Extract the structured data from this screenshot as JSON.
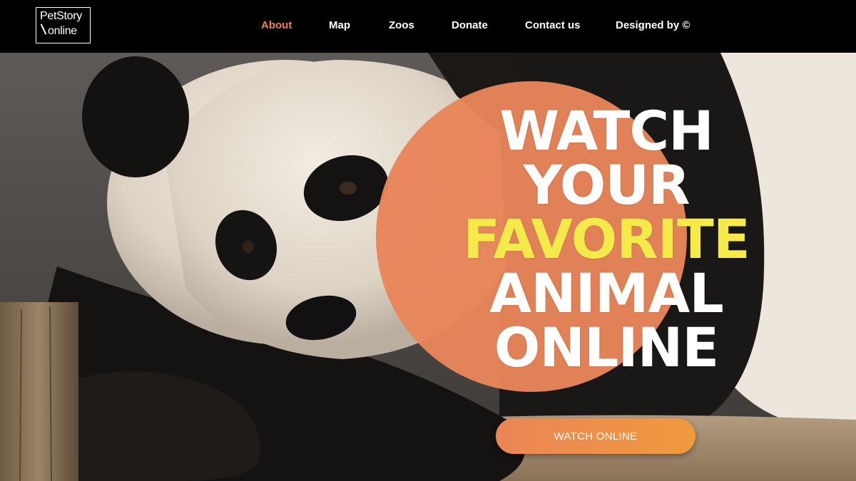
{
  "logo": {
    "line1": "PetStory",
    "line2": "online"
  },
  "nav": {
    "items": [
      {
        "label": "About",
        "active": true
      },
      {
        "label": "Map"
      },
      {
        "label": "Zoos"
      },
      {
        "label": "Donate"
      },
      {
        "label": "Contact us"
      },
      {
        "label": "Designed by ©"
      }
    ]
  },
  "hero": {
    "headline": {
      "line1": "WATCH",
      "line2": "YOUR",
      "line3": "FAVORITE",
      "line4": "ANIMAL",
      "line5": "ONLINE"
    },
    "cta_label": "WATCH ONLINE",
    "image": "panda-photo"
  },
  "colors": {
    "accent": "#e8855a",
    "highlight": "#f5ea4a",
    "header_bg": "#000000",
    "text": "#ffffff"
  }
}
